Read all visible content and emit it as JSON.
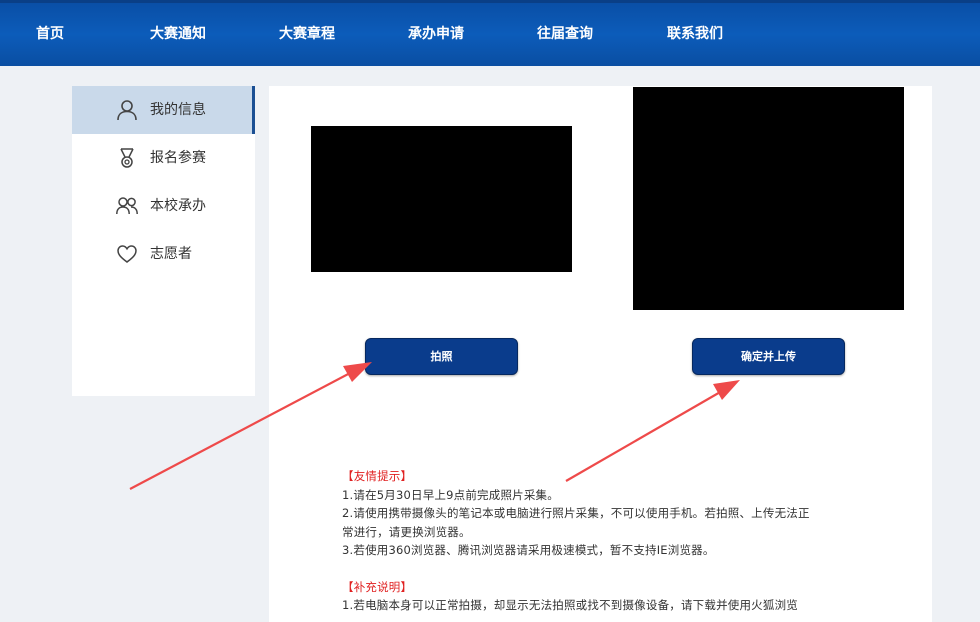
{
  "nav": {
    "items": [
      {
        "label": "首页"
      },
      {
        "label": "大赛通知"
      },
      {
        "label": "大赛章程"
      },
      {
        "label": "承办申请"
      },
      {
        "label": "往届查询"
      },
      {
        "label": "联系我们"
      }
    ]
  },
  "sidebar": {
    "items": [
      {
        "label": "我的信息",
        "icon": "user-icon",
        "active": true
      },
      {
        "label": "报名参赛",
        "icon": "medal-icon",
        "active": false
      },
      {
        "label": "本校承办",
        "icon": "users-icon",
        "active": false
      },
      {
        "label": "志愿者",
        "icon": "heart-icon",
        "active": false
      }
    ]
  },
  "main": {
    "capture_button_label": "拍照",
    "upload_button_label": "确定并上传"
  },
  "notes": {
    "tips_heading": "【友情提示】",
    "tips": [
      "1.请在5月30日早上9点前完成照片采集。",
      "2.请使用携带摄像头的笔记本或电脑进行照片采集，不可以使用手机。若拍照、上传无法正",
      "常进行，请更换浏览器。",
      "3.若使用360浏览器、腾讯浏览器请采用极速模式，暂不支持IE浏览器。"
    ],
    "supplement_heading": "【补充说明】",
    "supplement": [
      "1.若电脑本身可以正常拍摄，却显示无法拍照或找不到摄像设备，请下载并使用火狐浏览"
    ]
  },
  "colors": {
    "nav_bg": "#0c5cba",
    "button_bg": "#0a3c8c",
    "sidebar_active_bg": "#c9d9ea",
    "note_heading": "#e02020",
    "annotation_arrow": "#ee4a4a"
  }
}
